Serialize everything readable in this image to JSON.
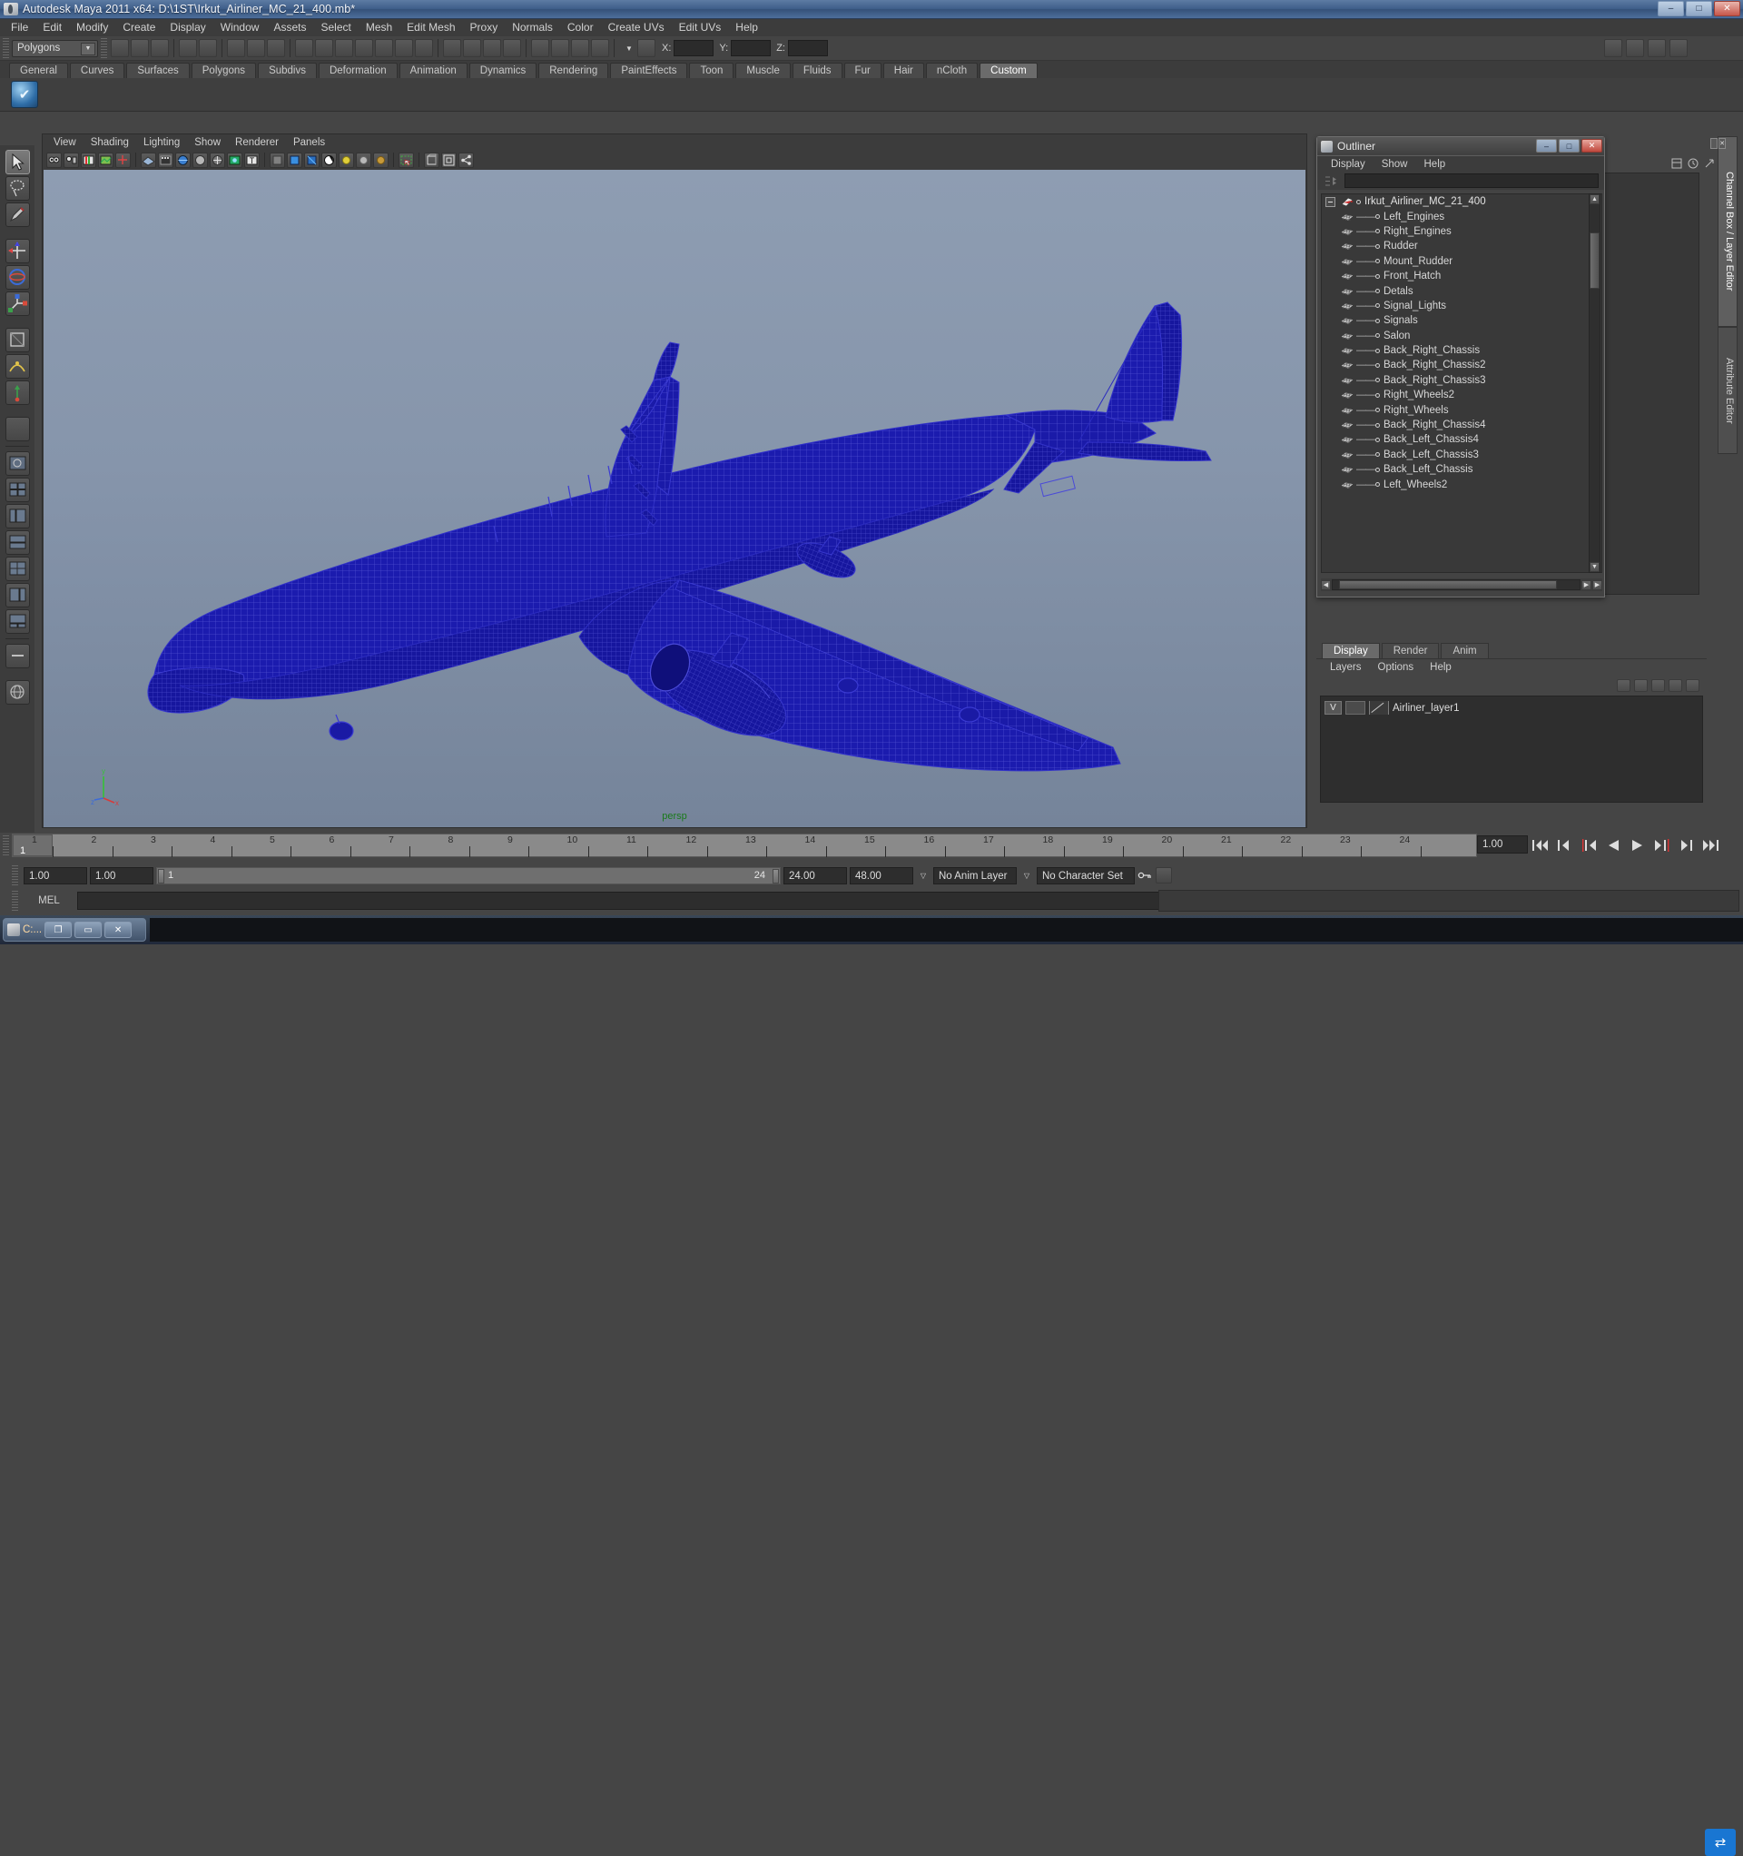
{
  "window": {
    "title": "Autodesk Maya 2011 x64: D:\\1ST\\Irkut_Airliner_MC_21_400.mb*",
    "minimize": "–",
    "maximize": "□",
    "close": "✕"
  },
  "menubar": {
    "items": [
      "File",
      "Edit",
      "Modify",
      "Create",
      "Display",
      "Window",
      "Assets",
      "Select",
      "Mesh",
      "Edit Mesh",
      "Proxy",
      "Normals",
      "Color",
      "Create UVs",
      "Edit UVs",
      "Help"
    ]
  },
  "toolbar": {
    "menuset": "Polygons",
    "x_label": "X:",
    "y_label": "Y:",
    "z_label": "Z:",
    "x_value": "",
    "y_value": "",
    "z_value": ""
  },
  "shelf": {
    "tabs": [
      "General",
      "Curves",
      "Surfaces",
      "Polygons",
      "Subdivs",
      "Deformation",
      "Animation",
      "Dynamics",
      "Rendering",
      "PaintEffects",
      "Toon",
      "Muscle",
      "Fluids",
      "Fur",
      "Hair",
      "nCloth",
      "Custom"
    ],
    "active": "Custom",
    "icon": "check-shelf-icon"
  },
  "viewport": {
    "menus": [
      "View",
      "Shading",
      "Lighting",
      "Show",
      "Renderer",
      "Panels"
    ],
    "camera_label": "persp",
    "axis": {
      "x": "x",
      "y": "y",
      "z": "z"
    },
    "model_color": "#1a1ab4",
    "bg_top": "#8e9db2",
    "bg_bottom": "#75849a"
  },
  "outliner": {
    "title": "Outliner",
    "minimize": "–",
    "maximize": "□",
    "close": "✕",
    "menus": [
      "Display",
      "Show",
      "Help"
    ],
    "search_value": "",
    "root": "Irkut_Airliner_MC_21_400",
    "items": [
      "Left_Engines",
      "Right_Engines",
      "Rudder",
      "Mount_Rudder",
      "Front_Hatch",
      "Detals",
      "Signal_Lights",
      "Signals",
      "Salon",
      "Back_Right_Chassis",
      "Back_Right_Chassis2",
      "Back_Right_Chassis3",
      "Right_Wheels2",
      "Right_Wheels",
      "Back_Right_Chassis4",
      "Back_Left_Chassis4",
      "Back_Left_Chassis3",
      "Back_Left_Chassis",
      "Left_Wheels2"
    ]
  },
  "layer_editor": {
    "tabs": [
      "Display",
      "Render",
      "Anim"
    ],
    "active_tab": "Display",
    "menus": [
      "Layers",
      "Options",
      "Help"
    ],
    "layers": [
      {
        "visibility": "V",
        "playback": "",
        "name": "Airliner_layer1"
      }
    ]
  },
  "side_tabs": {
    "items": [
      "Channel Box / Layer Editor",
      "Attribute Editor"
    ],
    "active": "Channel Box / Layer Editor"
  },
  "timeline": {
    "ticks": [
      "1",
      "2",
      "3",
      "4",
      "5",
      "6",
      "7",
      "8",
      "9",
      "10",
      "11",
      "12",
      "13",
      "14",
      "15",
      "16",
      "17",
      "18",
      "19",
      "20",
      "21",
      "22",
      "23",
      "24"
    ],
    "current_frame_marker": "1",
    "current_frame_field": "1.00",
    "playback_buttons": [
      "go-to-start",
      "step-back-key",
      "step-back-frame",
      "play-backwards",
      "play-forwards",
      "step-forward-frame",
      "step-forward-key",
      "go-to-end"
    ]
  },
  "range": {
    "anim_start": "1.00",
    "anim_start2": "1.00",
    "range_start_label": "1",
    "range_end_label": "24",
    "range_end": "24.00",
    "anim_end": "48.00",
    "anim_layer": "No Anim Layer",
    "character_set": "No Character Set"
  },
  "mel": {
    "label": "MEL",
    "value": ""
  },
  "taskbar": {
    "window_label": "C:...",
    "restore": "❐",
    "minimize": "▭",
    "close": "✕"
  }
}
